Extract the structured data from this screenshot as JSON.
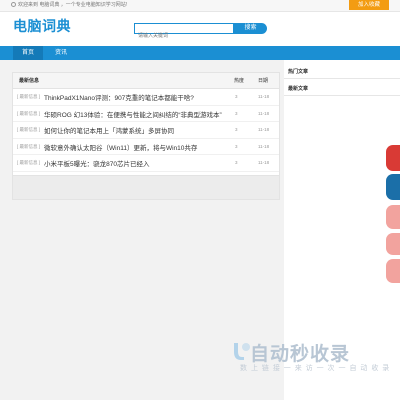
{
  "topbar": {
    "notice": "欢迎来到 电脑词典 ，一个专业电脑知识学习网站!",
    "favorite_label": "加入收藏"
  },
  "header": {
    "logo": "电脑词典",
    "search_placeholder": "请输入关键词",
    "search_button": "搜索"
  },
  "nav": {
    "items": [
      {
        "label": "首页",
        "active": true
      },
      {
        "label": "资讯",
        "active": false
      }
    ]
  },
  "article_list": {
    "header": {
      "title": "最新信息",
      "views": "热度",
      "date": "日期"
    },
    "rows": [
      {
        "category": "[ 最新信息 ]",
        "title": "ThinkPadX1Nano评测：907克重的笔记本都能干啥?",
        "views": "3",
        "date": "11-18"
      },
      {
        "category": "[ 最新信息 ]",
        "title": "华硕ROG 幻13体验：在便携与性能之间纠结的“非典型游戏本”",
        "views": "3",
        "date": "11-18"
      },
      {
        "category": "[ 最新信息 ]",
        "title": "如何让你的笔记本用上「鸿蒙系统」多屏协同",
        "views": "3",
        "date": "11-18"
      },
      {
        "category": "[ 最新信息 ]",
        "title": "微软意外确认太阳谷（Win11）更新，将与Win10共存",
        "views": "3",
        "date": "11-18"
      },
      {
        "category": "[ 最新信息 ]",
        "title": "小米平板5曝光：骁龙870芯片已经入",
        "views": "3",
        "date": "11-18"
      }
    ]
  },
  "sidebar": {
    "hot_title": "热门文章",
    "latest_title": "最新文章"
  },
  "watermark": {
    "main": "自动秒收录",
    "sub": "数 上 链 接 一 来 访 一 次 一 自 动 收 录"
  },
  "colors": {
    "brand": "#1b8fd3",
    "accent": "#f39c12"
  }
}
